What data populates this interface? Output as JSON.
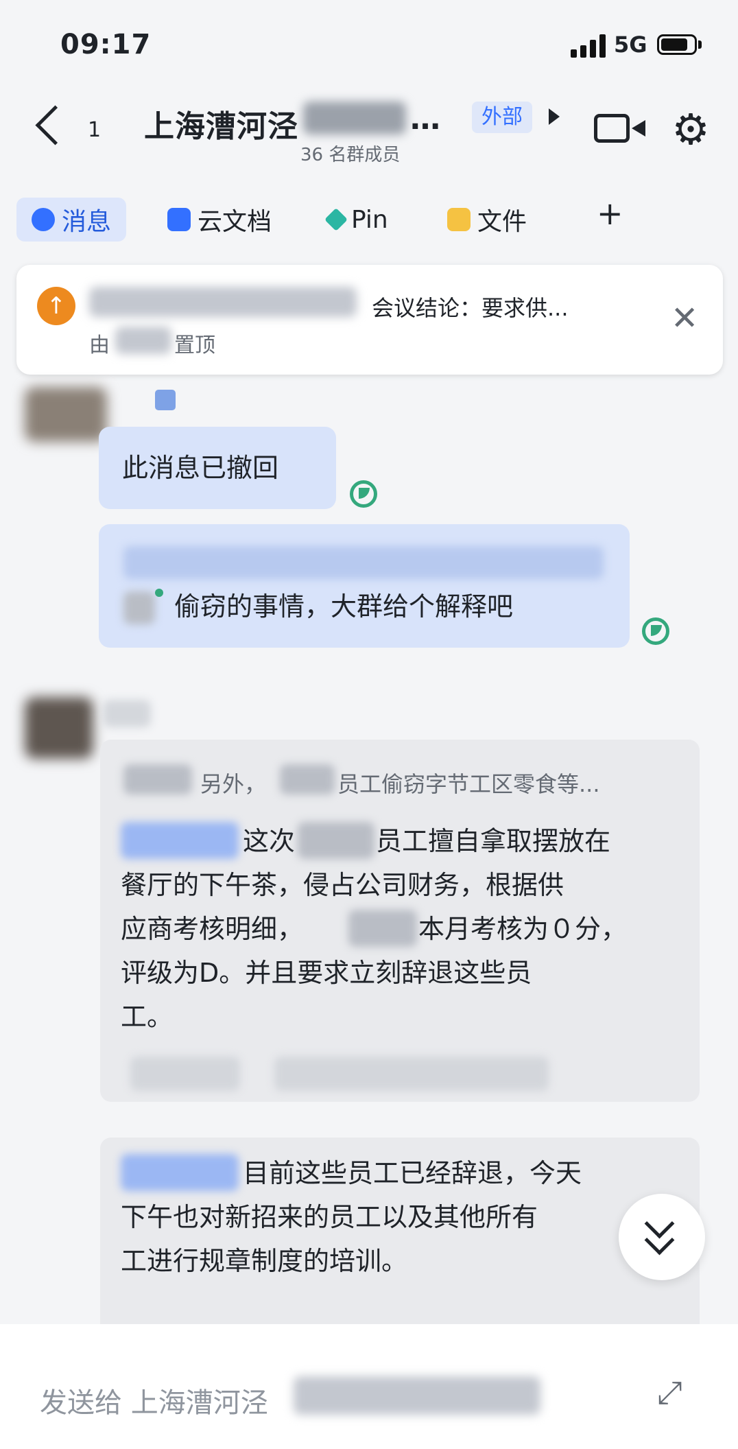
{
  "status_bar": {
    "time": "09:17",
    "network": "5G"
  },
  "header": {
    "unread_count": "1",
    "title": "上海漕河泾",
    "title_ellipsis": "…",
    "member_count": "36 名群成员",
    "external_tag": "外部"
  },
  "tabs": [
    {
      "label": "消息",
      "icon": "chat-bubble-icon",
      "active": true
    },
    {
      "label": "云文档",
      "icon": "doc-icon",
      "active": false
    },
    {
      "label": "Pin",
      "icon": "pin-icon",
      "active": false
    },
    {
      "label": "文件",
      "icon": "folder-icon",
      "active": false
    }
  ],
  "pinned": {
    "text": "会议结论：要求供...",
    "by_prefix": "由",
    "by_suffix": "置顶"
  },
  "messages": {
    "recalled": "此消息已撤回",
    "reply_line": "偷窃的事情，大群给个解释吧",
    "quote_prefix": "另外，",
    "quote_text": "员工偷窃字节工区零食等...",
    "msg1": {
      "line1_a": "这次",
      "line1_b": "员工擅自拿取摆放在",
      "line2": "餐厅的下午茶，侵占公司财务，根据供",
      "line3_a": "应商考核明细，",
      "line3_b": "本月考核为０分，",
      "line4": "评级为D。并且要求立刻辞退这些员",
      "line5": "工。"
    },
    "msg2": {
      "line1": "目前这些员工已经辞退，今天",
      "line2": "下午也对新招来的员工以及其他所有",
      "line3": "工进行规章制度的培训。"
    }
  },
  "input": {
    "placeholder": "发送给 上海漕河泾"
  },
  "colors": {
    "accent": "#3370ff",
    "read": "#34a87d",
    "pin": "#ed8a1f"
  }
}
